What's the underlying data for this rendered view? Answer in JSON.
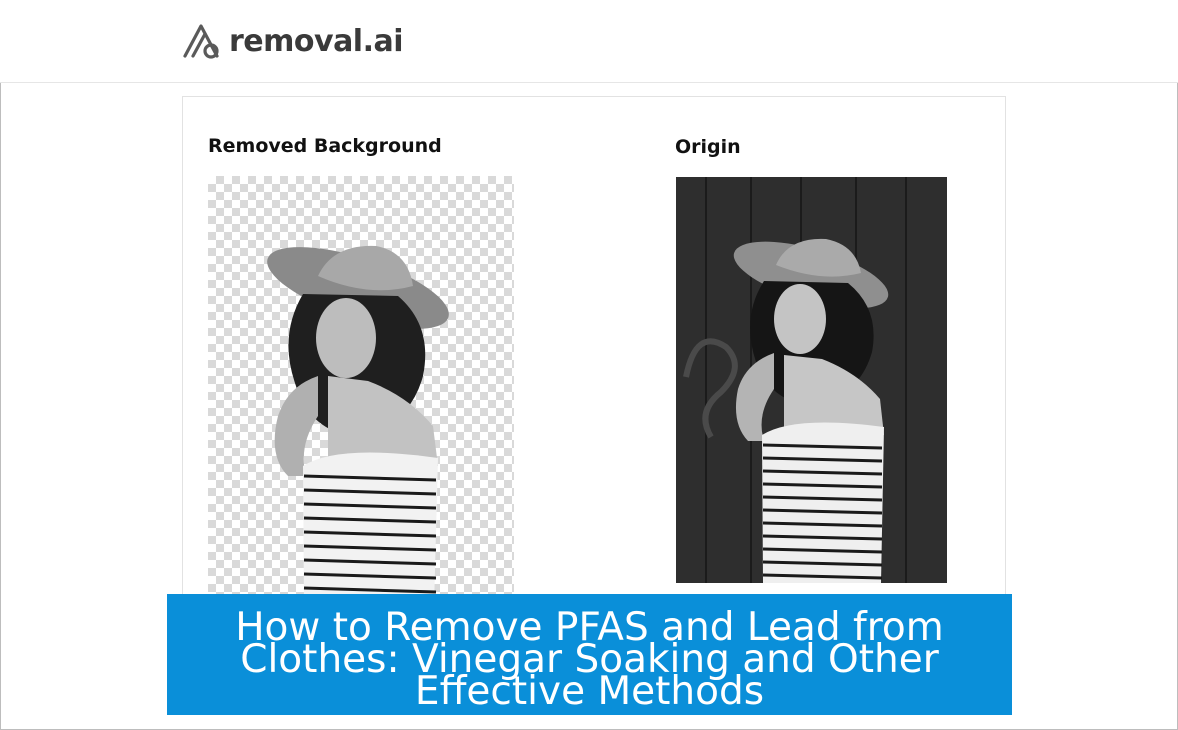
{
  "logo": {
    "text": "removal.ai",
    "icon": "removal-ai-logo-icon"
  },
  "panels": {
    "left_label": "Removed Background",
    "right_label": "Origin"
  },
  "banner": {
    "title": "How to Remove PFAS and Lead from Clothes: Vinegar Soaking and Other Effective Methods"
  },
  "colors": {
    "banner_bg": "#0a8fd9",
    "banner_text": "#ffffff",
    "logo_text": "#3a3a3a"
  }
}
